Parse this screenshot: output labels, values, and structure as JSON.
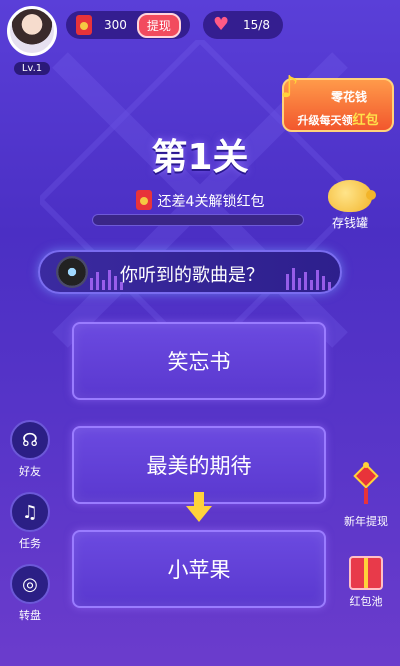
{
  "player": {
    "level": "Lv.1"
  },
  "currency": {
    "money": "300",
    "withdraw_label": "提现",
    "hearts": "15/8"
  },
  "ad_banner": {
    "line1": "零花钱",
    "line2_prefix": "升级每天领",
    "line2_highlight": "红包"
  },
  "level": {
    "title": "第1关",
    "unlock_text": "还差4关解锁红包",
    "progress": 0
  },
  "piggy_bank": {
    "label": "存钱罐"
  },
  "question": {
    "text": "你听到的歌曲是？"
  },
  "answers": [
    {
      "label": "笑忘书"
    },
    {
      "label": "最美的期待"
    },
    {
      "label": "小苹果"
    }
  ],
  "left_menu": [
    {
      "label": "好友",
      "icon": "headset-icon"
    },
    {
      "label": "任务",
      "icon": "task-music-icon"
    },
    {
      "label": "转盘",
      "icon": "wheel-icon"
    }
  ],
  "right_menu": [
    {
      "label": "新年提现",
      "icon": "chinese-knot-icon"
    },
    {
      "label": "红包池",
      "icon": "gift-box-icon"
    }
  ],
  "colors": {
    "accent_red": "#f24b5e",
    "bg_purple": "#4b2fc4",
    "answer_purple": "#6b4ae0"
  }
}
